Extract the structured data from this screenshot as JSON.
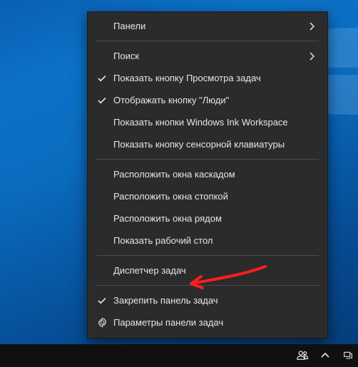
{
  "menu": {
    "items": [
      {
        "label": "Панели",
        "submenu": true
      },
      {
        "label": "Поиск",
        "submenu": true
      },
      {
        "label": "Показать кнопку Просмотра задач",
        "checked": true
      },
      {
        "label": "Отображать кнопку \"Люди\"",
        "checked": true
      },
      {
        "label": "Показать кнопки Windows Ink Workspace"
      },
      {
        "label": "Показать кнопку сенсорной клавиатуры"
      },
      {
        "label": "Расположить окна каскадом"
      },
      {
        "label": "Расположить окна стопкой"
      },
      {
        "label": "Расположить окна рядом"
      },
      {
        "label": "Показать рабочий стол"
      },
      {
        "label": "Диспетчер задач"
      },
      {
        "label": "Закрепить панель задач",
        "checked": true
      },
      {
        "label": "Параметры панели задач",
        "icon": "gear"
      }
    ]
  },
  "annotation": {
    "color": "#ff1e1e"
  }
}
